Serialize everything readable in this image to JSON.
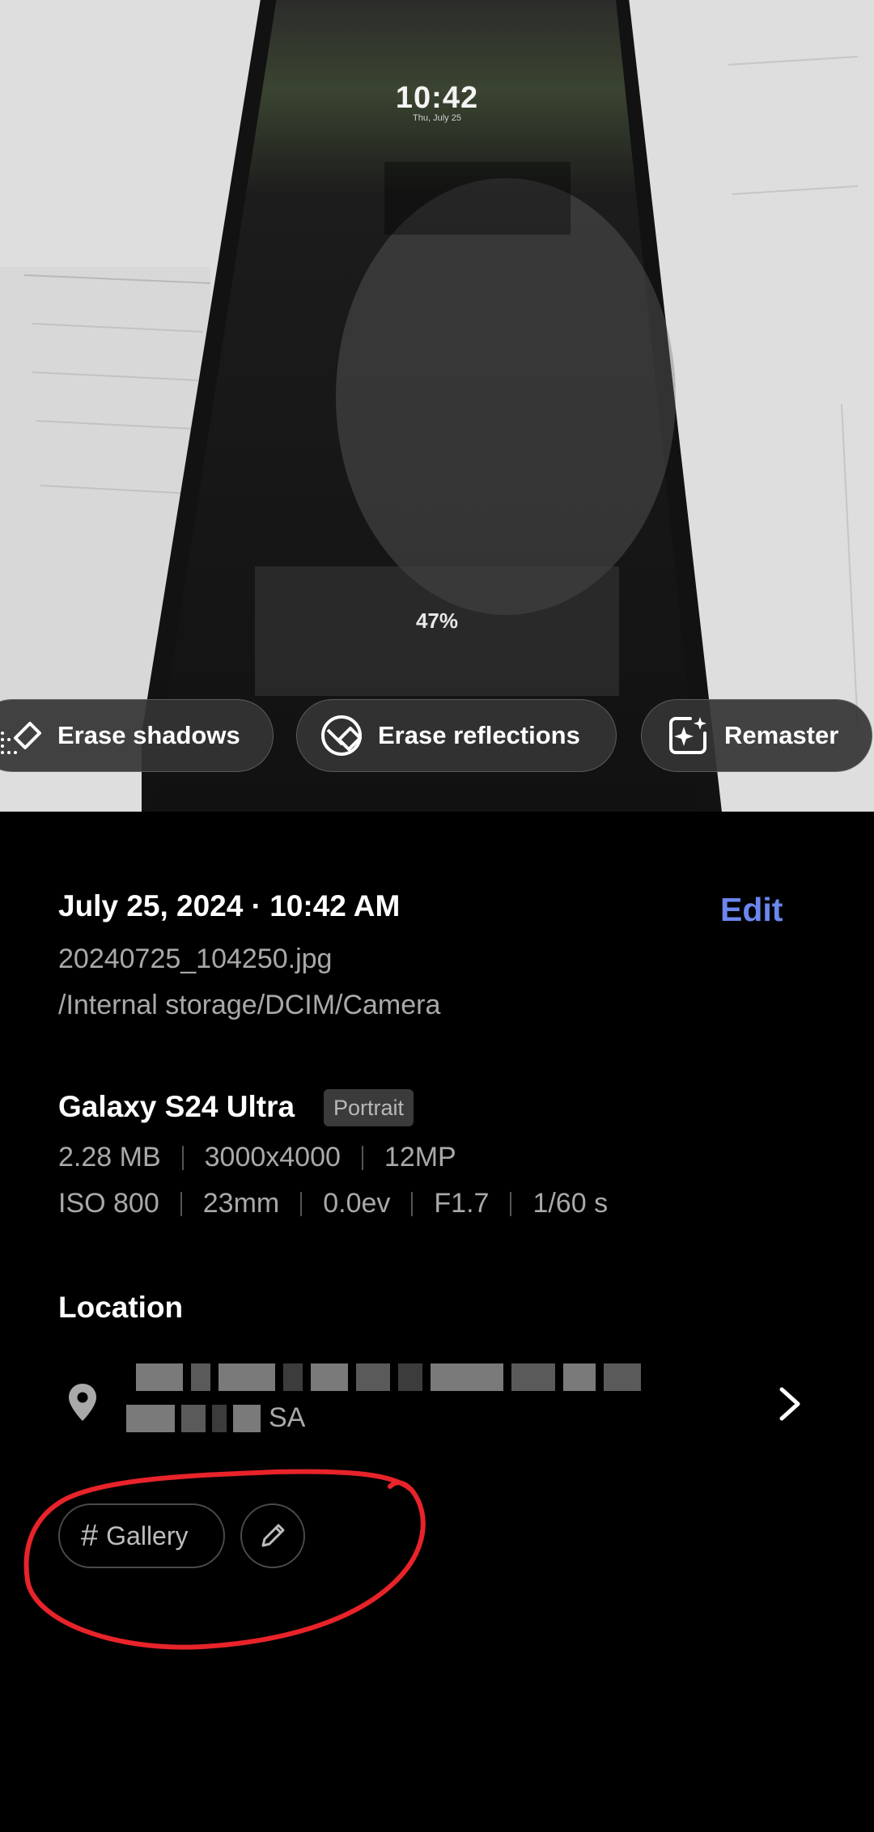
{
  "photo": {
    "lock_time": "10:42",
    "lock_date": "Thu, July 25",
    "lock_battery": "47%"
  },
  "chips": {
    "erase_shadows": "Erase shadows",
    "erase_reflections": "Erase reflections",
    "remaster": "Remaster"
  },
  "details": {
    "datetime": "July 25, 2024 · 10:42 AM",
    "edit_label": "Edit",
    "filename": "20240725_104250.jpg",
    "path": "/Internal storage/DCIM/Camera",
    "device": "Galaxy S24 Ultra",
    "mode_badge": "Portrait",
    "specs_row1": [
      "2.28 MB",
      "3000x4000",
      "12MP"
    ],
    "specs_row2": [
      "ISO 800",
      "23mm",
      "0.0ev",
      "F1.7",
      "1/60 s"
    ],
    "location_heading": "Location",
    "address_visible_suffix": "SA",
    "tag_label": "Gallery"
  },
  "colors": {
    "accent": "#6b86ee",
    "annotation": "#e8232a"
  }
}
